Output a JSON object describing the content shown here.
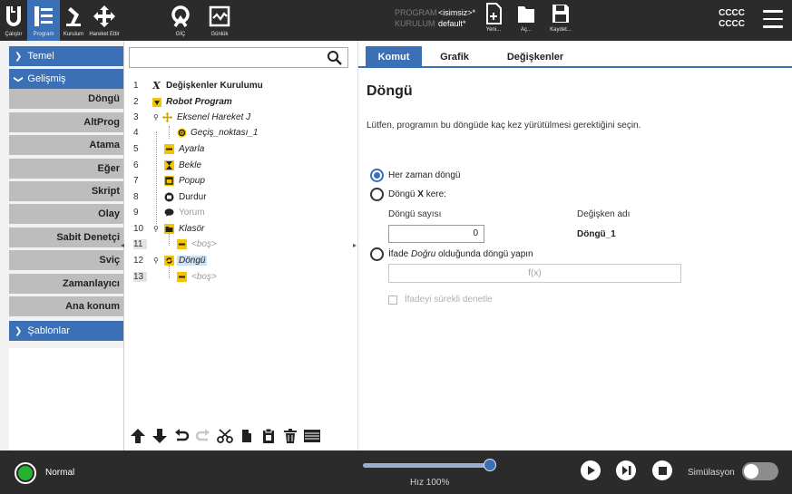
{
  "topnav": {
    "items": [
      {
        "label": "Çalıştır",
        "icon": "ur-logo-icon"
      },
      {
        "label": "Program",
        "icon": "program-tree-icon",
        "active": true
      },
      {
        "label": "Kurulum",
        "icon": "robot-arm-icon"
      },
      {
        "label": "Hareket Ettir",
        "icon": "move-arrows-icon"
      },
      {
        "label": "GİÇ",
        "icon": "io-icon"
      },
      {
        "label": "Günlük",
        "icon": "log-chart-icon"
      }
    ],
    "program_key": "PROGRAM",
    "program_value": "<isimsiz>*",
    "installation_key": "KURULUM",
    "installation_value": "default*",
    "new_label": "Yeni...",
    "open_label": "Aç...",
    "save_label": "Kaydet...",
    "cc_line1": "CCCC",
    "cc_line2": "CCCC"
  },
  "sidebar": {
    "temel": "Temel",
    "gelismis": "Gelişmiş",
    "items": [
      "Döngü",
      "AltProg",
      "Atama",
      "Eğer",
      "Skript",
      "Olay",
      "Sabit Denetçi",
      "Sviç",
      "Zamanlayıcı",
      "Ana konum"
    ],
    "sablonlar": "Şablonlar"
  },
  "tree": {
    "rows": [
      {
        "num": "1",
        "text": "Değişkenler Kurulumu"
      },
      {
        "num": "2",
        "text": "Robot Program"
      },
      {
        "num": "3",
        "text": "Eksenel Hareket J"
      },
      {
        "num": "4",
        "text": "Geçiş_noktası_1"
      },
      {
        "num": "5",
        "text": "Ayarla"
      },
      {
        "num": "6",
        "text": "Bekle"
      },
      {
        "num": "7",
        "text": "Popup"
      },
      {
        "num": "8",
        "text": "Durdur"
      },
      {
        "num": "9",
        "text": "Yorum"
      },
      {
        "num": "10",
        "text": "Klasör"
      },
      {
        "num": "11",
        "text": "<boş>"
      },
      {
        "num": "12",
        "text": "Döngü"
      },
      {
        "num": "13",
        "text": "<boş>"
      }
    ]
  },
  "panel": {
    "tabs": [
      "Komut",
      "Grafik",
      "Değişkenler"
    ],
    "title": "Döngü",
    "description": "Lütfen, programın bu döngüde kaç kez yürütülmesi gerektiğini seçin.",
    "opt_always": "Her zaman döngü",
    "opt_x_pre": "Döngü ",
    "opt_x_bold": "X",
    "opt_x_post": " kere:",
    "count_label": "Döngü sayısı",
    "count_value": "0",
    "var_label": "Değişken adı",
    "var_value": "Döngü_1",
    "opt_expr_pre": "İfade ",
    "opt_expr_it": "Doğru",
    "opt_expr_post": " olduğunda döngü yapın",
    "fx_placeholder": "f(x)",
    "check_label": "İfadeyi sürekli denetle"
  },
  "bottom": {
    "status": "Normal",
    "speed_label": "Hız 100%",
    "speed_value": 1.0,
    "sim_label": "Simülasyon"
  },
  "colors": {
    "accent": "#3b6fb6",
    "bar": "#2b2b2b",
    "status_green": "#25b131"
  }
}
